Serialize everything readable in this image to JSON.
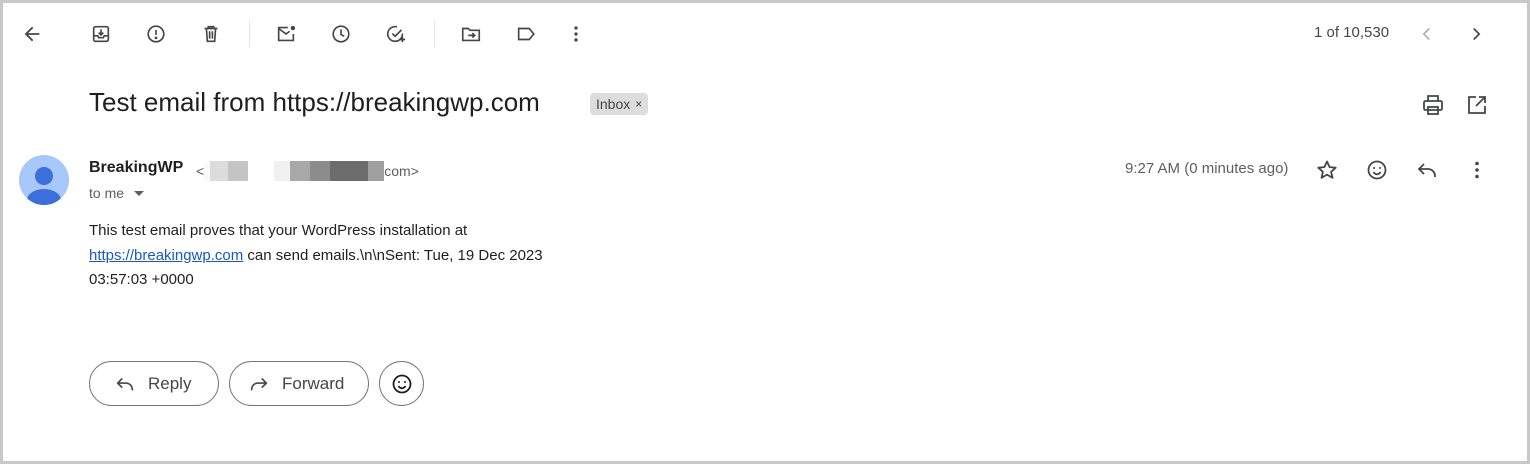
{
  "toolbar": {
    "icons": [
      "back-arrow-icon",
      "archive-icon",
      "report-spam-icon",
      "delete-icon",
      "mark-unread-icon",
      "snooze-icon",
      "add-to-tasks-icon",
      "move-to-icon",
      "label-icon",
      "more-vert-icon"
    ],
    "counter": "1 of 10,530",
    "nav_icons": [
      "chevron-left-icon",
      "chevron-right-icon"
    ]
  },
  "email": {
    "subject": "Test email from https://breakingwp.com",
    "label": "Inbox",
    "label_remove": "×",
    "sender_name": "BreakingWP",
    "sender_email_open": "<",
    "sender_email_tail": "com>",
    "recipient": "to me",
    "time": "9:27 AM (0 minutes ago)",
    "body_line1": "This test email proves that your WordPress installation at",
    "body_link": "https://breakingwp.com",
    "body_line2_rest": " can send emails.\\n\\nSent: Tue, 19 Dec 2023",
    "body_line3": "03:57:03 +0000"
  },
  "actions": {
    "reply_label": "Reply",
    "forward_label": "Forward"
  },
  "colors": {
    "link": "#1a57c8",
    "avatar_bg": "#a8c7fa",
    "avatar_fg": "#3c6fdc",
    "chip_bg": "#dddddd"
  }
}
